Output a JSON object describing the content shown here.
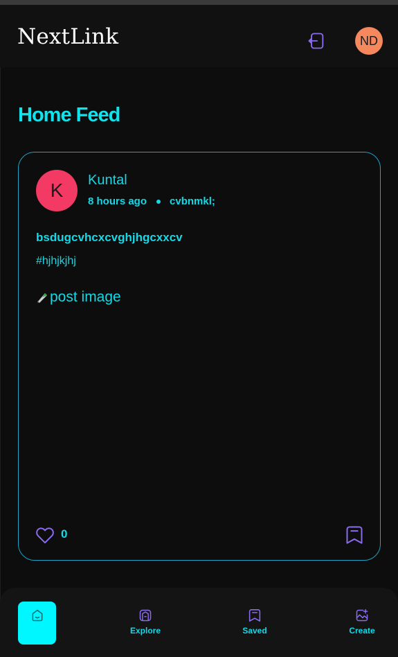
{
  "header": {
    "brand": "NextLink",
    "logout_icon": "logout-icon",
    "user_initials": "ND",
    "user_avatar_color": "#f5885c"
  },
  "page": {
    "title": "Home Feed"
  },
  "post": {
    "author_initial": "K",
    "author_name": "Kuntal",
    "avatar_color": "#f23a64",
    "time_ago": "8 hours ago",
    "location": "cvbnmkl;",
    "caption": "bsdugcvhcxcvghjhgcxxcv",
    "hashtag": "#hjhjkjhj",
    "image_alt": "post image",
    "like_count": "0",
    "like_icon": "heart-icon",
    "save_icon": "bookmark-icon"
  },
  "bottom_nav": {
    "home_icon": "home-icon",
    "explore_label": "Explore",
    "saved_label": "Saved",
    "create_label": "Create"
  },
  "colors": {
    "accent": "#14d8e6",
    "active_nav": "#00f7ff",
    "icon_purple": "#8b6cf0",
    "card_border": "#1fa3c9"
  }
}
